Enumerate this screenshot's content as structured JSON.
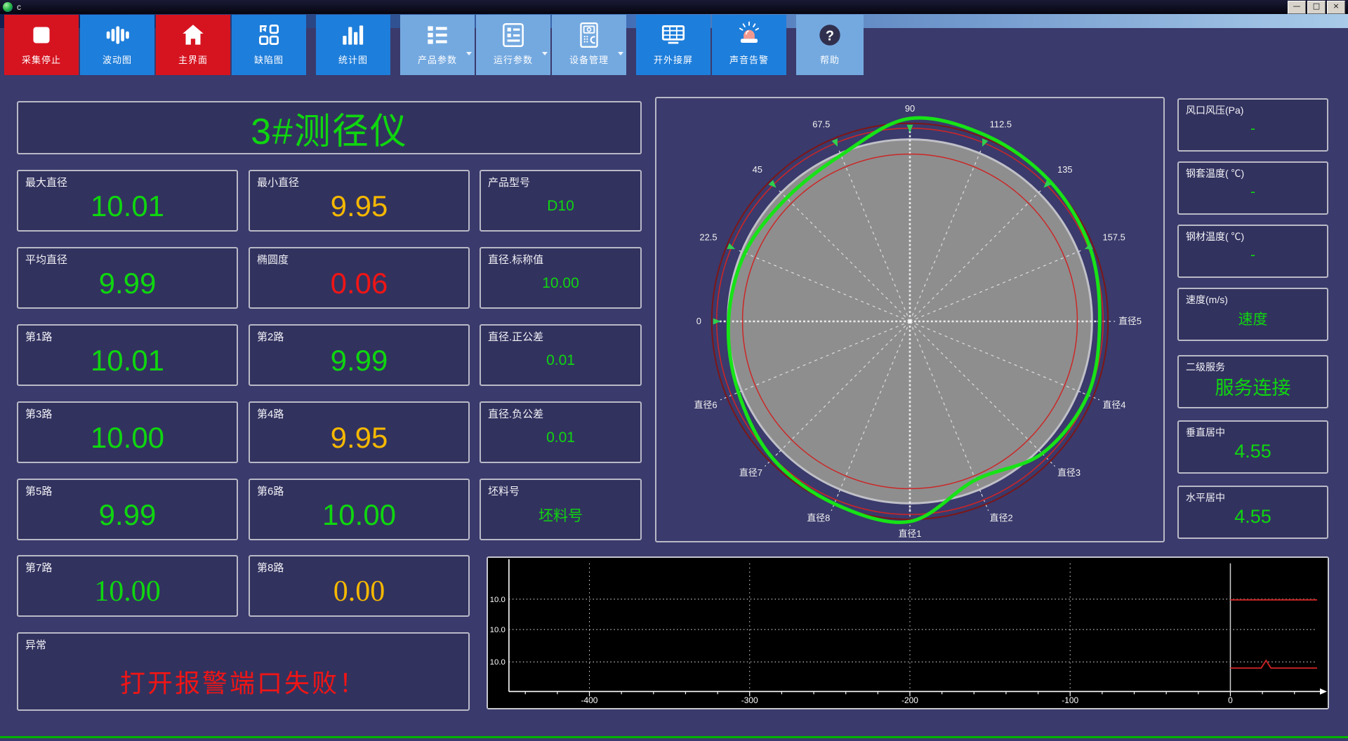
{
  "window": {
    "title": "c",
    "controls": [
      {
        "id": "minimize",
        "glyph": "—"
      },
      {
        "id": "restore",
        "glyph": "□"
      },
      {
        "id": "close",
        "glyph": "×"
      }
    ]
  },
  "toolbar": {
    "buttons": [
      {
        "id": "stop-acquisition",
        "label": "采集停止",
        "color": "red",
        "icon": "stop-icon"
      },
      {
        "id": "wave-chart",
        "label": "波动图",
        "color": "blue",
        "icon": "wave-chart-icon"
      },
      {
        "id": "main-screen",
        "label": "主界面",
        "color": "red",
        "icon": "home-icon"
      },
      {
        "id": "defect-chart",
        "label": "缺陷图",
        "color": "blue",
        "icon": "defect-chart-icon"
      },
      {
        "id": "statistics-chart",
        "label": "统计图",
        "color": "blue",
        "icon": "stats-chart-icon",
        "group_gap_before": true
      },
      {
        "id": "product-params",
        "label": "产品参数",
        "color": "light",
        "icon": "product-params-icon",
        "dropdown": true,
        "group_gap_before": true
      },
      {
        "id": "run-params",
        "label": "运行参数",
        "color": "light",
        "icon": "run-params-icon",
        "dropdown": true
      },
      {
        "id": "device-management",
        "label": "设备管理",
        "color": "light",
        "icon": "device-management-icon",
        "dropdown": true
      },
      {
        "id": "external-screen",
        "label": "开外接屏",
        "color": "blue",
        "icon": "external-screen-icon",
        "group_gap_before": true
      },
      {
        "id": "sound-alarm",
        "label": "声音告警",
        "color": "blue",
        "icon": "sound-alarm-icon"
      },
      {
        "id": "help",
        "label": "帮助",
        "color": "light",
        "icon": "help-icon",
        "group_gap_before": true
      }
    ]
  },
  "header": {
    "title": "3#测径仪"
  },
  "metrics": {
    "columns": [
      [
        {
          "label": "最大直径",
          "value": "10.01",
          "color": "green"
        },
        {
          "label": "平均直径",
          "value": "9.99",
          "color": "green"
        },
        {
          "label": "第1路",
          "value": "10.01",
          "color": "green"
        },
        {
          "label": "第3路",
          "value": "10.00",
          "color": "green"
        },
        {
          "label": "第5路",
          "value": "9.99",
          "color": "green"
        },
        {
          "label": "第7路",
          "value": "10.00",
          "color": "green",
          "serif": true
        }
      ],
      [
        {
          "label": "最小直径",
          "value": "9.95",
          "color": "amber"
        },
        {
          "label": "椭圆度",
          "value": "0.06",
          "color": "red"
        },
        {
          "label": "第2路",
          "value": "9.99",
          "color": "green"
        },
        {
          "label": "第4路",
          "value": "9.95",
          "color": "amber"
        },
        {
          "label": "第6路",
          "value": "10.00",
          "color": "green"
        },
        {
          "label": "第8路",
          "value": "0.00",
          "color": "amber",
          "serif": true
        }
      ],
      [
        {
          "label": "产品型号",
          "value": "D10",
          "color": "green",
          "small": true
        },
        {
          "label": "直径.标称值",
          "value": "10.00",
          "color": "green",
          "small": true
        },
        {
          "label": "直径.正公差",
          "value": "0.01",
          "color": "green",
          "small": true
        },
        {
          "label": "直径.负公差",
          "value": "0.01",
          "color": "green",
          "small": true
        },
        {
          "label": "坯料号",
          "value": "坯料号",
          "color": "green",
          "small": true
        }
      ]
    ]
  },
  "alarm": {
    "label": "异常",
    "message": "打开报警端口失败！"
  },
  "sidebar": {
    "panels": [
      {
        "label": "风口风压(Pa)",
        "value": "-",
        "color": "green"
      },
      {
        "label": "钢套温度( ℃)",
        "value": "-",
        "color": "green"
      },
      {
        "label": "钢材温度( ℃)",
        "value": "-",
        "color": "green"
      },
      {
        "label": "速度(m/s)",
        "value": "速度",
        "color": "green"
      },
      {
        "label": "二级服务",
        "value": "服务连接",
        "color": "green",
        "big": true
      },
      {
        "label": "垂直居中",
        "value": "4.55",
        "color": "green",
        "big": true
      },
      {
        "label": "水平居中",
        "value": "4.55",
        "color": "green",
        "big": true
      }
    ]
  },
  "chart_data": [
    {
      "type": "polar-profile",
      "spokes": [
        {
          "screen_angle_deg": 0,
          "label": "直径5",
          "green_r": 272,
          "arrow": false
        },
        {
          "screen_angle_deg": 22.5,
          "label": "157.5",
          "green_r": 279,
          "arrow": true
        },
        {
          "screen_angle_deg": 45,
          "label": "135",
          "green_r": 284,
          "arrow": true
        },
        {
          "screen_angle_deg": 67.5,
          "label": "112.5",
          "green_r": 288,
          "arrow": true
        },
        {
          "screen_angle_deg": 90,
          "label": "90",
          "green_r": 291,
          "arrow": true
        },
        {
          "screen_angle_deg": 112.5,
          "label": "67.5",
          "green_r": 258,
          "arrow": true
        },
        {
          "screen_angle_deg": 135,
          "label": "45",
          "green_r": 250,
          "arrow": true
        },
        {
          "screen_angle_deg": 157.5,
          "label": "22.5",
          "green_r": 256,
          "arrow": true
        },
        {
          "screen_angle_deg": 180,
          "label": "0",
          "green_r": 260,
          "arrow": true
        },
        {
          "screen_angle_deg": 202.5,
          "label": "直径6",
          "green_r": 266,
          "arrow": false
        },
        {
          "screen_angle_deg": 225,
          "label": "直径7",
          "green_r": 278,
          "arrow": false
        },
        {
          "screen_angle_deg": 247.5,
          "label": "直径8",
          "green_r": 283,
          "arrow": false
        },
        {
          "screen_angle_deg": 270,
          "label": "直径1",
          "green_r": 287,
          "arrow": false
        },
        {
          "screen_angle_deg": 292.5,
          "label": "直径2",
          "green_r": 246,
          "arrow": false
        },
        {
          "screen_angle_deg": 315,
          "label": "直径3",
          "green_r": 268,
          "arrow": false
        },
        {
          "screen_angle_deg": 337.5,
          "label": "直径4",
          "green_r": 276,
          "arrow": false
        }
      ],
      "circles": {
        "gray_disc_r": 261,
        "red_outer_dark_r": 284,
        "red_outer_r": 277,
        "red_inner_r": 240
      },
      "colors": {
        "profile": "#17e317",
        "tolerance": "#cc2626",
        "tolerance_dark": "#7d1616",
        "disc": "#8e8e8e",
        "spoke": "#d8d8de",
        "label": "#f2f2f2",
        "arrow": "#2fd04f"
      }
    },
    {
      "type": "line",
      "x_tick_labels": [
        "-400",
        "-300",
        "-200",
        "-100",
        "0"
      ],
      "y_tick_labels": [
        "10.0",
        "10.0",
        "10.0"
      ],
      "background": "#000000",
      "grid": true,
      "series": [
        {
          "name": "upper-red-line",
          "color": "#c42222",
          "from_x_label": "0",
          "flat": true
        },
        {
          "name": "lower-red-line",
          "color": "#c42222",
          "from_x_label": "0",
          "flat": true,
          "spike": true
        }
      ]
    }
  ],
  "colors": {
    "green": "#0fd60f",
    "amber": "#f5b800",
    "red": "#f01515",
    "background": "#3a3a6c",
    "panel": "#32325f",
    "panel_border": "#b9b9c7",
    "toolbar_red": "#d61420",
    "toolbar_blue": "#1e7edb",
    "toolbar_light": "#74a9e0",
    "footer_line": "#00b400"
  }
}
